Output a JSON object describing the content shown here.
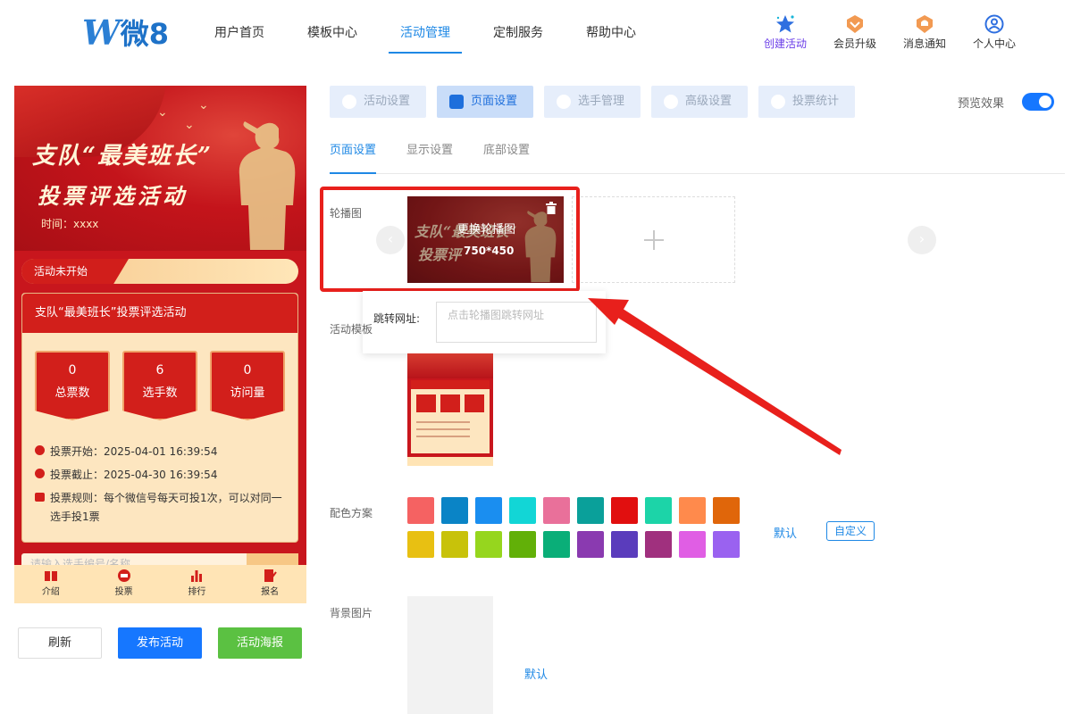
{
  "brand": {
    "logo_w": "W",
    "logo_text": "微8"
  },
  "nav": {
    "items": [
      {
        "label": "用户首页",
        "active": false
      },
      {
        "label": "模板中心",
        "active": false
      },
      {
        "label": "活动管理",
        "active": true
      },
      {
        "label": "定制服务",
        "active": false
      },
      {
        "label": "帮助中心",
        "active": false
      }
    ]
  },
  "top_actions": [
    {
      "label": "创建活动",
      "icon": "star-icon"
    },
    {
      "label": "会员升级",
      "icon": "vip-icon"
    },
    {
      "label": "消息通知",
      "icon": "bell-icon"
    },
    {
      "label": "个人中心",
      "icon": "user-icon"
    }
  ],
  "phone": {
    "banner_line1": "支队“最美班长”",
    "banner_line2": "投票评选活动",
    "banner_time": "时间：xxxx",
    "status_tag": "活动未开始",
    "card_title": "支队“最美班长”投票评选活动",
    "stats": [
      {
        "value": "0",
        "label": "总票数"
      },
      {
        "value": "6",
        "label": "选手数"
      },
      {
        "value": "0",
        "label": "访问量"
      }
    ],
    "vote_start": "投票开始：2025-04-01 16:39:54",
    "vote_end": "投票截止：2025-04-30 16:39:54",
    "rule_line1": "投票规则：每个微信号每天可投1次，可以对同一",
    "rule_line2": "选手投1票",
    "search_placeholder": "请输入选手编号/名称",
    "tabs": [
      "介绍",
      "投票",
      "排行",
      "报名"
    ]
  },
  "left_buttons": {
    "refresh": "刷新",
    "publish": "发布活动",
    "poster": "活动海报"
  },
  "step_tabs": [
    {
      "label": "活动设置",
      "active": false
    },
    {
      "label": "页面设置",
      "active": true
    },
    {
      "label": "选手管理",
      "active": false
    },
    {
      "label": "高级设置",
      "active": false
    },
    {
      "label": "投票统计",
      "active": false
    }
  ],
  "preview": {
    "label": "预览效果",
    "enabled": true
  },
  "sub_tabs": [
    {
      "label": "页面设置",
      "active": true
    },
    {
      "label": "显示设置",
      "active": false
    },
    {
      "label": "底部设置",
      "active": false
    }
  ],
  "carousel": {
    "label": "轮播图",
    "slide_line1": "支队“最美班长”",
    "slide_line2": "投票评",
    "change_text": "更换轮播图",
    "size_text": "750*450",
    "url_label": "跳转网址:",
    "url_placeholder": "点击轮播图跳转网址"
  },
  "template": {
    "label": "活动模板"
  },
  "color_scheme": {
    "label": "配色方案",
    "colors": [
      "#f56262",
      "#0a84c6",
      "#1a8ef0",
      "#12d6d6",
      "#e9709a",
      "#0aa09a",
      "#e10f0f",
      "#1cd4a8",
      "#ff8a4c",
      "#e0660a",
      "#e8c012",
      "#c8c20a",
      "#96d61e",
      "#62b008",
      "#0aae78",
      "#8a3ab0",
      "#5a3cbc",
      "#a0307e",
      "#e05ee4",
      "#9a62f0"
    ],
    "default_label": "默认",
    "custom_label": "自定义"
  },
  "background": {
    "label": "背景图片",
    "default_label": "默认"
  },
  "accent_color": "#1e88e5",
  "highlight_color": "#e8201c"
}
